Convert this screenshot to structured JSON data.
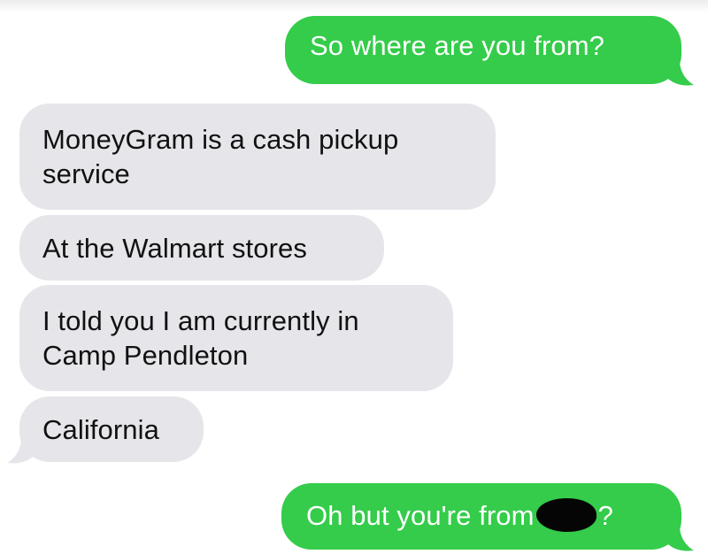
{
  "conversation": {
    "messages": [
      {
        "direction": "outgoing",
        "text": "So where are you from?"
      },
      {
        "direction": "incoming",
        "text": "MoneyGram is a cash pickup service"
      },
      {
        "direction": "incoming",
        "text": "At the Walmart stores"
      },
      {
        "direction": "incoming",
        "text": "I told you I am currently in Camp Pendleton"
      },
      {
        "direction": "incoming",
        "text": "California"
      },
      {
        "direction": "outgoing",
        "text_before_redaction": "Oh but you're from",
        "text_after_redaction": "?"
      }
    ]
  },
  "colors": {
    "outgoing_bubble": "#34cc4a",
    "incoming_bubble": "#e6e5ea",
    "outgoing_text": "#ffffff",
    "incoming_text": "#111111",
    "redaction": "#050505",
    "background": "#ffffff"
  }
}
